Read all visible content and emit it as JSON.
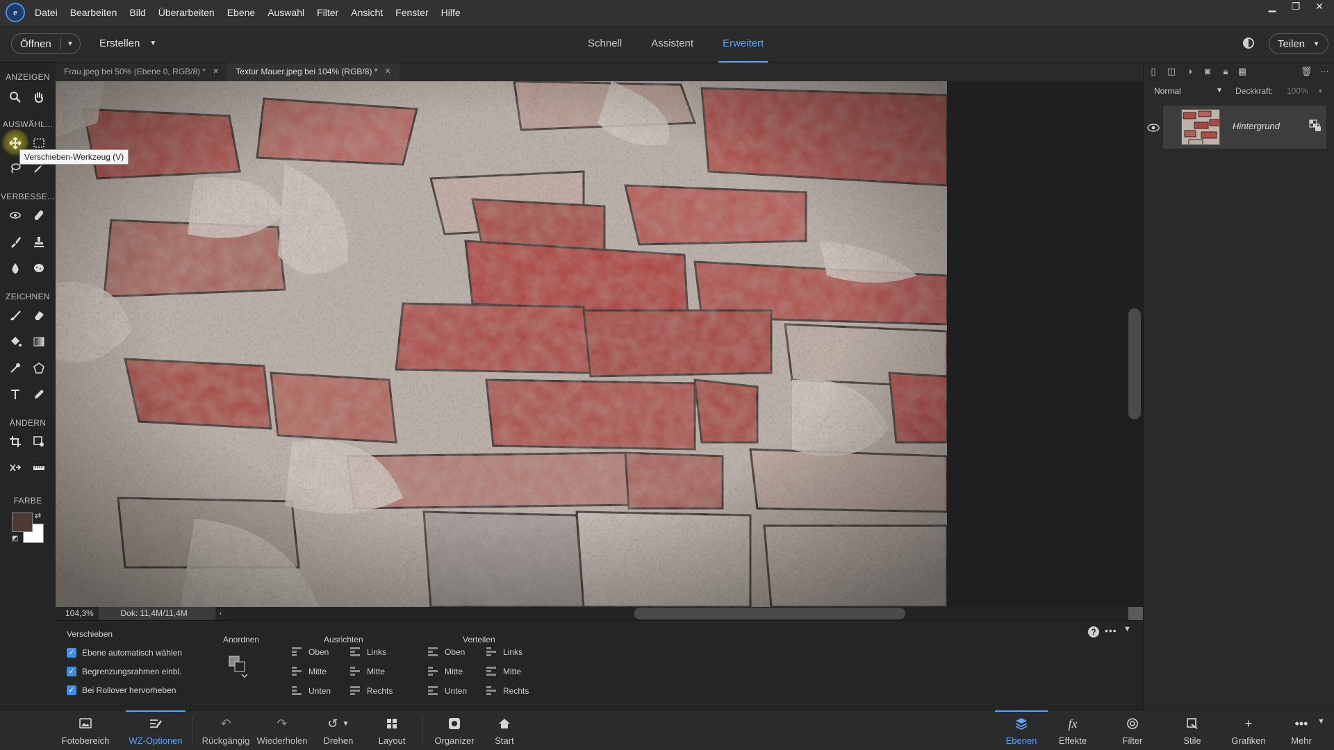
{
  "menubar": {
    "items": [
      "Datei",
      "Bearbeiten",
      "Bild",
      "Überarbeiten",
      "Ebene",
      "Auswahl",
      "Filter",
      "Ansicht",
      "Fenster",
      "Hilfe"
    ]
  },
  "modebar": {
    "open_label": "Öffnen",
    "create_label": "Erstellen",
    "tabs": [
      "Schnell",
      "Assistent",
      "Erweitert"
    ],
    "active_tab": "Erweitert",
    "share_label": "Teilen"
  },
  "toolbox": {
    "sections": {
      "view": "ANZEIGEN",
      "select": "AUSWÄHL...",
      "enhance": "VERBESSE...",
      "draw": "ZEICHNEN",
      "modify": "ÄNDERN",
      "color": "FARBE"
    },
    "tooltip": "Verschieben-Werkzeug (V)",
    "foreground_color": "#4b3a33",
    "background_color": "#ffffff"
  },
  "document_tabs": [
    {
      "label": "Frau.jpeg bei 50% (Ebene 0, RGB/8) *",
      "active": false
    },
    {
      "label": "Textur Mauer.jpeg bei 104% (RGB/8) *",
      "active": true
    }
  ],
  "status": {
    "zoom": "104,3%",
    "doc_info": "Dok: 11,4M/11,4M"
  },
  "tool_options": {
    "tool_name": "Verschieben",
    "checkboxes": [
      {
        "label": "Ebene automatisch wählen",
        "checked": true
      },
      {
        "label": "Begrenzungsrahmen einbl.",
        "checked": true
      },
      {
        "label": "Bei Rollover hervorheben",
        "checked": true
      }
    ],
    "arrange_label": "Anordnen",
    "align_label": "Ausrichten",
    "distribute_label": "Verteilen",
    "align_col1": [
      "Oben",
      "Mitte",
      "Unten"
    ],
    "align_col2": [
      "Links",
      "Mitte",
      "Rechts"
    ],
    "distribute_col1": [
      "Oben",
      "Mitte",
      "Unten"
    ],
    "distribute_col2": [
      "Links",
      "Mitte",
      "Rechts"
    ]
  },
  "layers_panel": {
    "blend_mode": "Normal",
    "opacity_label": "Deckkraft:",
    "opacity_value": "100%",
    "layers": [
      {
        "name": "Hintergrund",
        "visible": true
      }
    ]
  },
  "bottombar": {
    "left": [
      "Fotobereich",
      "WZ-Optionen",
      "Rückgängig",
      "Wiederholen",
      "Drehen",
      "Layout",
      "Organizer",
      "Start"
    ],
    "right": [
      "Ebenen",
      "Effekte",
      "Filter",
      "Stile",
      "Grafiken",
      "Mehr"
    ],
    "active_left": "WZ-Optionen",
    "active_right": "Ebenen"
  },
  "colors": {
    "accent": "#5aa6ff",
    "checkbox": "#3b8fe8"
  }
}
